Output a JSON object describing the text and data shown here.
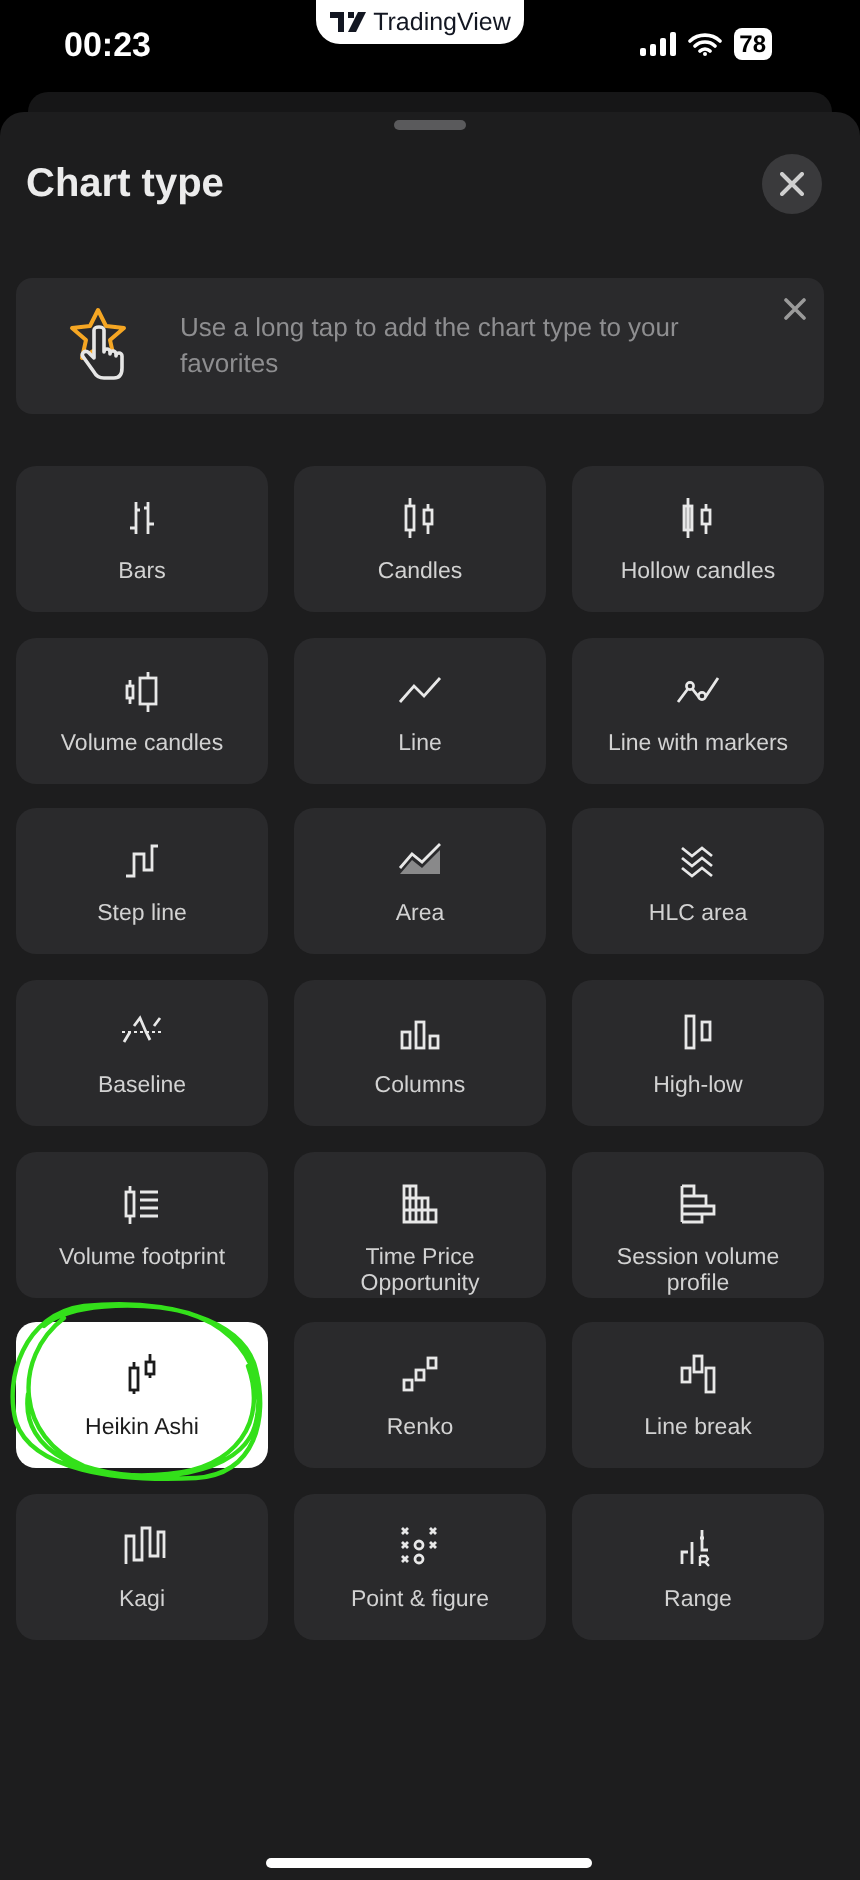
{
  "status_bar": {
    "time": "00:23",
    "app_badge": "TradingView",
    "battery": "78"
  },
  "sheet": {
    "title": "Chart type"
  },
  "hint": {
    "text": "Use a long tap to add the chart type to your favorites"
  },
  "tiles": [
    {
      "label": "Bars",
      "selected": false,
      "circled": false
    },
    {
      "label": "Candles",
      "selected": false,
      "circled": false
    },
    {
      "label": "Hollow candles",
      "selected": false,
      "circled": false
    },
    {
      "label": "Volume candles",
      "selected": false,
      "circled": false
    },
    {
      "label": "Line",
      "selected": false,
      "circled": false
    },
    {
      "label": "Line with markers",
      "selected": false,
      "circled": false
    },
    {
      "label": "Step line",
      "selected": false,
      "circled": false
    },
    {
      "label": "Area",
      "selected": false,
      "circled": false
    },
    {
      "label": "HLC area",
      "selected": false,
      "circled": false
    },
    {
      "label": "Baseline",
      "selected": false,
      "circled": false
    },
    {
      "label": "Columns",
      "selected": false,
      "circled": false
    },
    {
      "label": "High-low",
      "selected": false,
      "circled": false
    },
    {
      "label": "Volume footprint",
      "selected": false,
      "circled": false
    },
    {
      "label": "Time Price Opportunity",
      "selected": false,
      "circled": false
    },
    {
      "label": "Session volume profile",
      "selected": false,
      "circled": false
    },
    {
      "label": "Heikin Ashi",
      "selected": true,
      "circled": true
    },
    {
      "label": "Renko",
      "selected": false,
      "circled": false
    },
    {
      "label": "Line break",
      "selected": false,
      "circled": false
    },
    {
      "label": "Kagi",
      "selected": false,
      "circled": false
    },
    {
      "label": "Point & figure",
      "selected": false,
      "circled": false
    },
    {
      "label": "Range",
      "selected": false,
      "circled": false
    }
  ]
}
